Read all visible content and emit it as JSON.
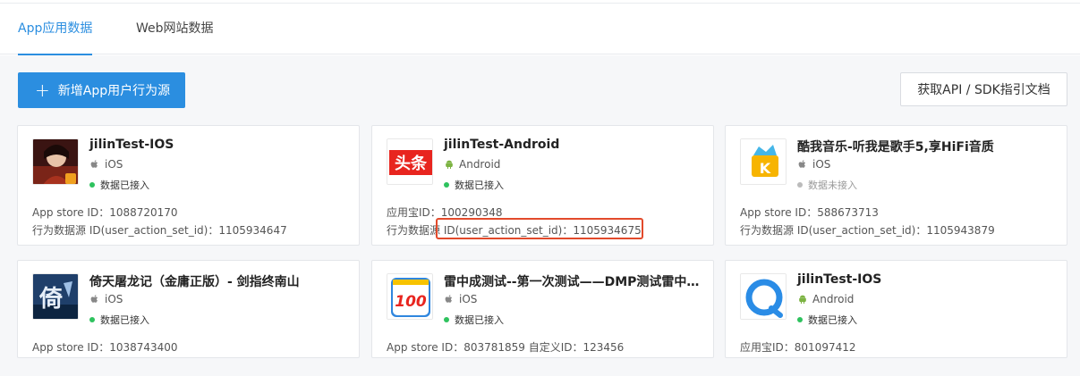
{
  "tabs": [
    {
      "label": "App应用数据",
      "active": true
    },
    {
      "label": "Web网站数据",
      "active": false
    }
  ],
  "toolbar": {
    "add_label": "新增App用户行为源",
    "api_label": "获取API / SDK指引文档"
  },
  "colors": {
    "accent": "#2b8ee0",
    "connected": "#2ec25e",
    "not_connected": "#bbbbbb",
    "highlight": "#e24a2b"
  },
  "cards": [
    {
      "title": "jilinTest-IOS",
      "platform": "iOS",
      "platform_icon": "apple-icon",
      "status": "数据已接入",
      "meta1": "App store ID：1088720170",
      "meta2": "行为数据源 ID(user_action_set_id)：1105934647",
      "app_icon": "game-character-icon"
    },
    {
      "title": "jilinTest-Android",
      "platform": "Android",
      "platform_icon": "android-icon",
      "status": "数据已接入",
      "meta1": "应用宝ID：100290348",
      "meta2": "行为数据源 ID(user_action_set_id)：1105934675",
      "app_icon": "toutiao-icon",
      "app_icon_text": "头条"
    },
    {
      "title": "酷我音乐-听我是歌手5,享HiFi音质",
      "platform": "iOS",
      "platform_icon": "apple-icon",
      "status": "数据未接入",
      "meta1": "App store ID：588673713",
      "meta2": "行为数据源 ID(user_action_set_id)：1105943879",
      "app_icon": "kuwo-music-icon",
      "app_icon_text": "K"
    },
    {
      "title": "倚天屠龙记（金庸正版）- 剑指终南山",
      "platform": "iOS",
      "platform_icon": "apple-icon",
      "status": "数据已接入",
      "meta1": "App store ID：1038743400",
      "app_icon": "yitian-game-icon",
      "app_icon_text": "倚"
    },
    {
      "title": "雷中成测试--第一次测试——DMP测试雷中…",
      "platform": "iOS",
      "platform_icon": "apple-icon",
      "status": "数据已接入",
      "meta1": "App store ID：803781859    自定义ID：123456",
      "app_icon": "homework-100-icon",
      "app_icon_text": "100"
    },
    {
      "title": "jilinTest-IOS",
      "platform": "Android",
      "platform_icon": "android-icon",
      "status": "数据已接入",
      "meta1": "应用宝ID：801097412",
      "app_icon": "browser-icon"
    }
  ]
}
